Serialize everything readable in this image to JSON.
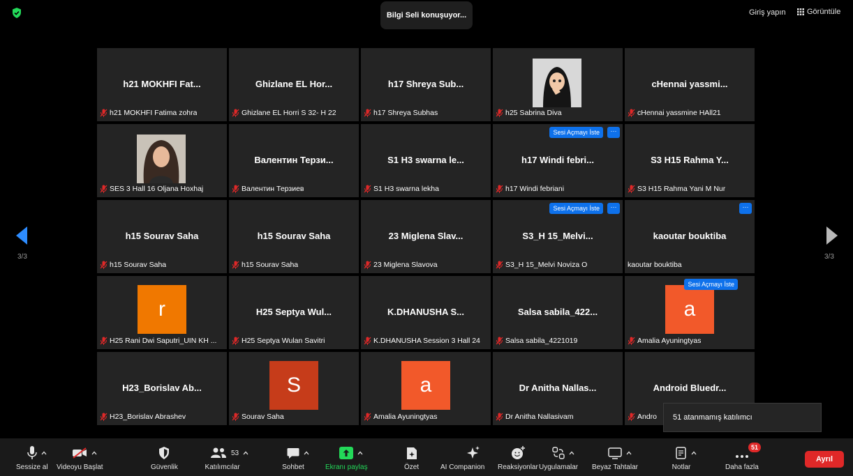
{
  "topbar": {
    "speaking": "Bilgi Seli konuşuyor...",
    "signin": "Giriş yapın",
    "view": "Görüntüle"
  },
  "paging": {
    "left_page": "3/3",
    "right_page": "3/3"
  },
  "colors": {
    "accent_blue": "#0e71eb",
    "leave_red": "#e02828",
    "share_green": "#23d959",
    "tile_bg": "#242424"
  },
  "tiles": [
    {
      "title": "h21 MOKHFI Fat...",
      "name": "h21 MOKHFI Fatima zohra",
      "muted": true
    },
    {
      "title": "Ghizlane EL Hor...",
      "name": "Ghizlane EL Horri S 32- H 22",
      "muted": true
    },
    {
      "title": "h17 Shreya Sub...",
      "name": "h17 Shreya Subhas",
      "muted": true
    },
    {
      "title": "",
      "name": "h25 Sabrina Diva",
      "muted": true,
      "photo": "avatar-illustration"
    },
    {
      "title": "cHennai yassmi...",
      "name": "cHennai yassmine HAll21",
      "muted": true
    },
    {
      "title": "",
      "name": "SES 3 Hall 16 Oljana Hoxhaj",
      "muted": true,
      "photo": "portrait-photo"
    },
    {
      "title": "Валентин Терзи...",
      "name": "Валентин Терзиев",
      "muted": true
    },
    {
      "title": "S1 H3 swarna le...",
      "name": "S1 H3 swarna lekha",
      "muted": true
    },
    {
      "title": "h17 Windi febri...",
      "name": "h17 Windi febriani",
      "muted": true,
      "request": "Sesi Açmayı İste",
      "more": "···"
    },
    {
      "title": "S3 H15 Rahma Y...",
      "name": "S3 H15 Rahma Yani M Nur",
      "muted": true
    },
    {
      "title": "h15 Sourav Saha",
      "name": "h15 Sourav Saha",
      "muted": true
    },
    {
      "title": "h15 Sourav Saha",
      "name": "h15 Sourav Saha",
      "muted": true
    },
    {
      "title": "23 Miglena Slav...",
      "name": "23 Miglena Slavova",
      "muted": true
    },
    {
      "title": "S3_H 15_Melvi...",
      "name": "S3_H 15_Melvi Noviza O",
      "muted": true,
      "request": "Sesi Açmayı İste",
      "more": "···"
    },
    {
      "title": "kaoutar bouktiba",
      "name": "kaoutar bouktiba",
      "muted": false,
      "more": "···"
    },
    {
      "title": "",
      "name": "H25 Rani Dwi Saputri_UIN KH ...",
      "muted": true,
      "letter": "r",
      "letter_color": "#f07800"
    },
    {
      "title": "H25 Septya Wul...",
      "name": "H25 Septya Wulan Savitri",
      "muted": true
    },
    {
      "title": "K.DHANUSHA S...",
      "name": "K.DHANUSHA Session 3 Hall 24",
      "muted": true
    },
    {
      "title": "Salsa sabila_422...",
      "name": "Salsa sabila_4221019",
      "muted": true
    },
    {
      "title": "",
      "name": "Amalia Ayuningtyas",
      "muted": true,
      "letter": "a",
      "letter_color": "#f2592a",
      "request": "Sesi Açmayı İste"
    },
    {
      "title": "H23_Borislav Ab...",
      "name": "H23_Borislav Abrashev",
      "muted": true
    },
    {
      "title": "",
      "name": "Sourav Saha",
      "muted": true,
      "letter": "S",
      "letter_color": "#c63c1a"
    },
    {
      "title": "",
      "name": "Amalia Ayuningtyas",
      "muted": true,
      "letter": "a",
      "letter_color": "#f2592a"
    },
    {
      "title": "Dr Anitha Nallas...",
      "name": "Dr Anitha Nallasivam",
      "muted": true
    },
    {
      "title": "Android Bluedr...",
      "name": "Andro",
      "muted": true
    }
  ],
  "tooltip": "51 atanmamış katılımcı",
  "toolbar": {
    "mute": "Sessize al",
    "video": "Videoyu Başlat",
    "security": "Güvenlik",
    "participants": "Katılımcılar",
    "participants_count": "53",
    "chat": "Sohbet",
    "share": "Ekranı paylaş",
    "summary": "Özet",
    "ai": "AI Companion",
    "reactions": "Reaksiyonlar",
    "apps": "Uygulamalar",
    "whiteboard": "Beyaz Tahtalar",
    "notes": "Notlar",
    "more": "Daha fazla",
    "more_badge": "51",
    "leave": "Ayrıl"
  }
}
